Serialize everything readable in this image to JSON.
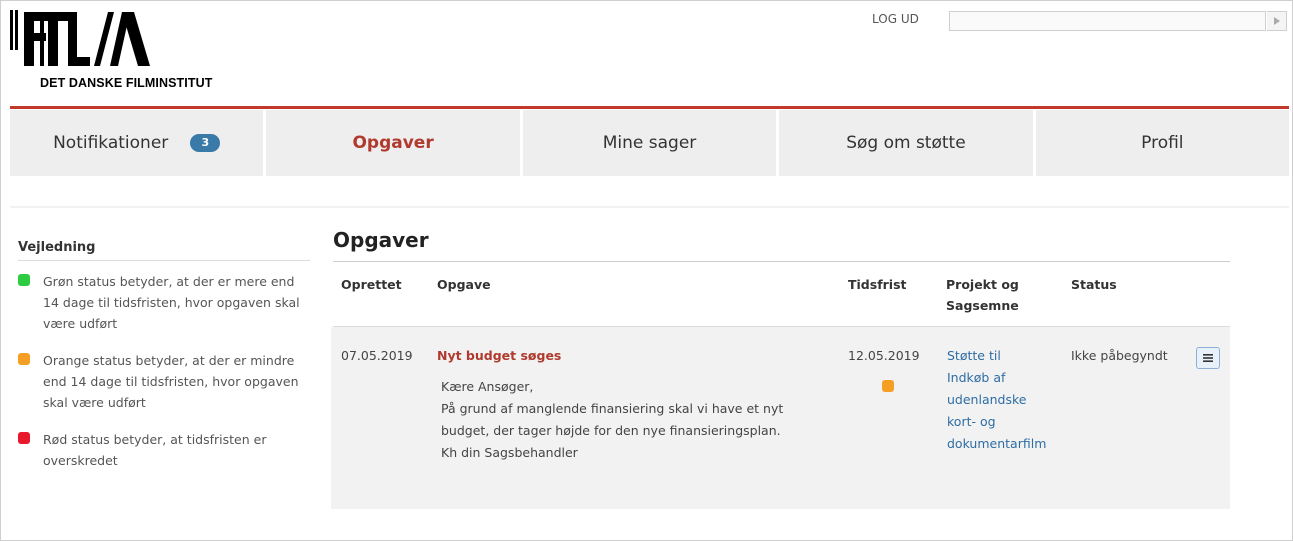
{
  "header": {
    "logo_text": "DET DANSKE FILMINSTITUT",
    "logout_label": "LOG UD",
    "search_value": ""
  },
  "nav": {
    "items": [
      {
        "label": "Notifikationer",
        "badge": "3"
      },
      {
        "label": "Opgaver",
        "active": true
      },
      {
        "label": "Mine sager"
      },
      {
        "label": "Søg om støtte"
      },
      {
        "label": "Profil"
      }
    ]
  },
  "sidebar": {
    "title": "Vejledning",
    "legend": [
      {
        "color": "#2ecc40",
        "text": "Grøn status betyder, at der er mere end 14 dage til tidsfristen, hvor opgaven skal være udført"
      },
      {
        "color": "#f5a025",
        "text": "Orange status betyder, at der er mindre end 14 dage til tidsfristen, hvor opgaven skal være udført"
      },
      {
        "color": "#e8192c",
        "text": "Rød status betyder, at tidsfristen er overskredet"
      }
    ]
  },
  "main": {
    "title": "Opgaver",
    "columns": {
      "created": "Oprettet",
      "task": "Opgave",
      "deadline": "Tidsfrist",
      "project_line1": "Projekt og",
      "project_line2": "Sagsemne",
      "status": "Status"
    },
    "rows": [
      {
        "created": "07.05.2019",
        "task_title": "Nyt budget søges",
        "task_body": [
          "Kære Ansøger,",
          "På grund af manglende finansiering skal vi have et nyt",
          "budget, der tager højde for den nye finansieringsplan.",
          "Kh din Sagsbehandler"
        ],
        "deadline": "12.05.2019",
        "deadline_status_color": "#f5a025",
        "project": [
          "Støtte til",
          "Indkøb af",
          "udenlandske",
          "kort- og",
          "dokumentarfilm"
        ],
        "status": "Ikke påbegyndt",
        "menu_icon": "hamburger-icon"
      }
    ]
  },
  "colors": {
    "accent": "#c0392b",
    "badge": "#3a7aa8",
    "link": "#2e6da4"
  }
}
